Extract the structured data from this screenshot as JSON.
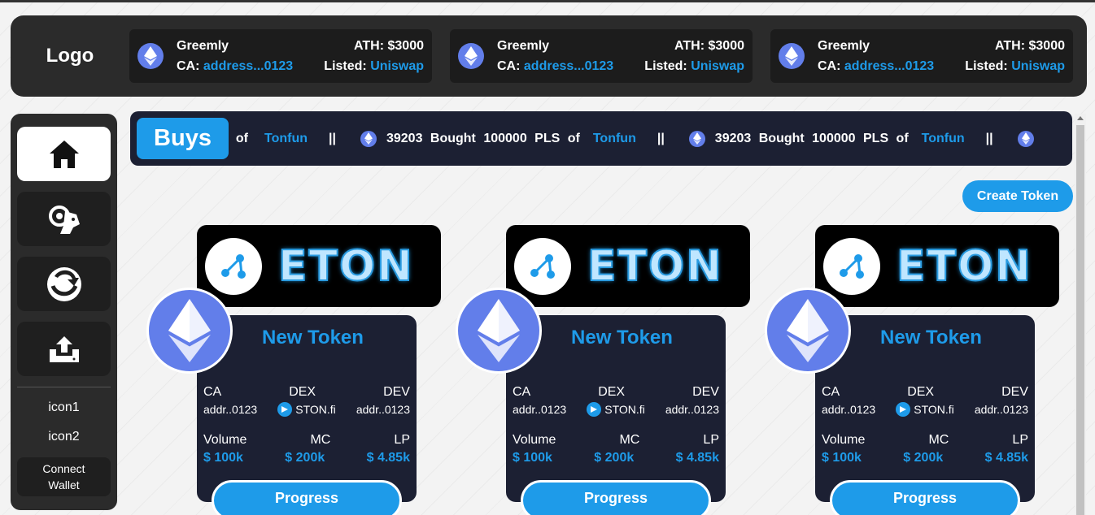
{
  "header": {
    "logo": "Logo",
    "tickers": [
      {
        "name": "Greemly",
        "ca_label": "CA:",
        "ca": "address...0123",
        "ath": "ATH: $3000",
        "listed_label": "Listed:",
        "listed": "Uniswap"
      },
      {
        "name": "Greemly",
        "ca_label": "CA:",
        "ca": "address...0123",
        "ath": "ATH: $3000",
        "listed_label": "Listed:",
        "listed": "Uniswap"
      },
      {
        "name": "Greemly",
        "ca_label": "CA:",
        "ca": "address...0123",
        "ath": "ATH: $3000",
        "listed_label": "Listed:",
        "listed": "Uniswap"
      }
    ]
  },
  "sidebar": {
    "items": [
      {
        "icon": "home-icon",
        "active": true
      },
      {
        "icon": "ram-icon",
        "active": false
      },
      {
        "icon": "swap-arrow-icon",
        "active": false
      },
      {
        "icon": "upload-icon",
        "active": false
      }
    ],
    "link1": "icon1",
    "link2": "icon2",
    "connect": "Connect Wallet"
  },
  "buys": {
    "label": "Buys",
    "partial": "LS of",
    "partial_link": "Tonfun",
    "separator": "||",
    "items": [
      {
        "text": "39203 Bought 100000 PLS of",
        "link": "Tonfun"
      },
      {
        "text": "39203 Bought 100000 PLS of",
        "link": "Tonfun"
      }
    ]
  },
  "create_token": "Create Token",
  "tokens": [
    {
      "banner": "ETON",
      "title": "New Token",
      "ca_label": "CA",
      "ca": "addr..0123",
      "dex_label": "DEX",
      "dex": "STON.fi",
      "dev_label": "DEV",
      "dev": "addr..0123",
      "volume_label": "Volume",
      "volume": "$ 100k",
      "mc_label": "MC",
      "mc": "$ 200k",
      "lp_label": "LP",
      "lp": "$ 4.85k",
      "progress": "Progress"
    },
    {
      "banner": "ETON",
      "title": "New Token",
      "ca_label": "CA",
      "ca": "addr..0123",
      "dex_label": "DEX",
      "dex": "STON.fi",
      "dev_label": "DEV",
      "dev": "addr..0123",
      "volume_label": "Volume",
      "volume": "$ 100k",
      "mc_label": "MC",
      "mc": "$ 200k",
      "lp_label": "LP",
      "lp": "$ 4.85k",
      "progress": "Progress"
    },
    {
      "banner": "ETON",
      "title": "New Token",
      "ca_label": "CA",
      "ca": "addr..0123",
      "dex_label": "DEX",
      "dex": "STON.fi",
      "dev_label": "DEV",
      "dev": "addr..0123",
      "volume_label": "Volume",
      "volume": "$ 100k",
      "mc_label": "MC",
      "mc": "$ 200k",
      "lp_label": "LP",
      "lp": "$ 4.85k",
      "progress": "Progress"
    }
  ],
  "colors": {
    "accent": "#1e9be9",
    "eth": "#627eea",
    "panel": "#2b2b2b",
    "card": "#1c2033"
  }
}
